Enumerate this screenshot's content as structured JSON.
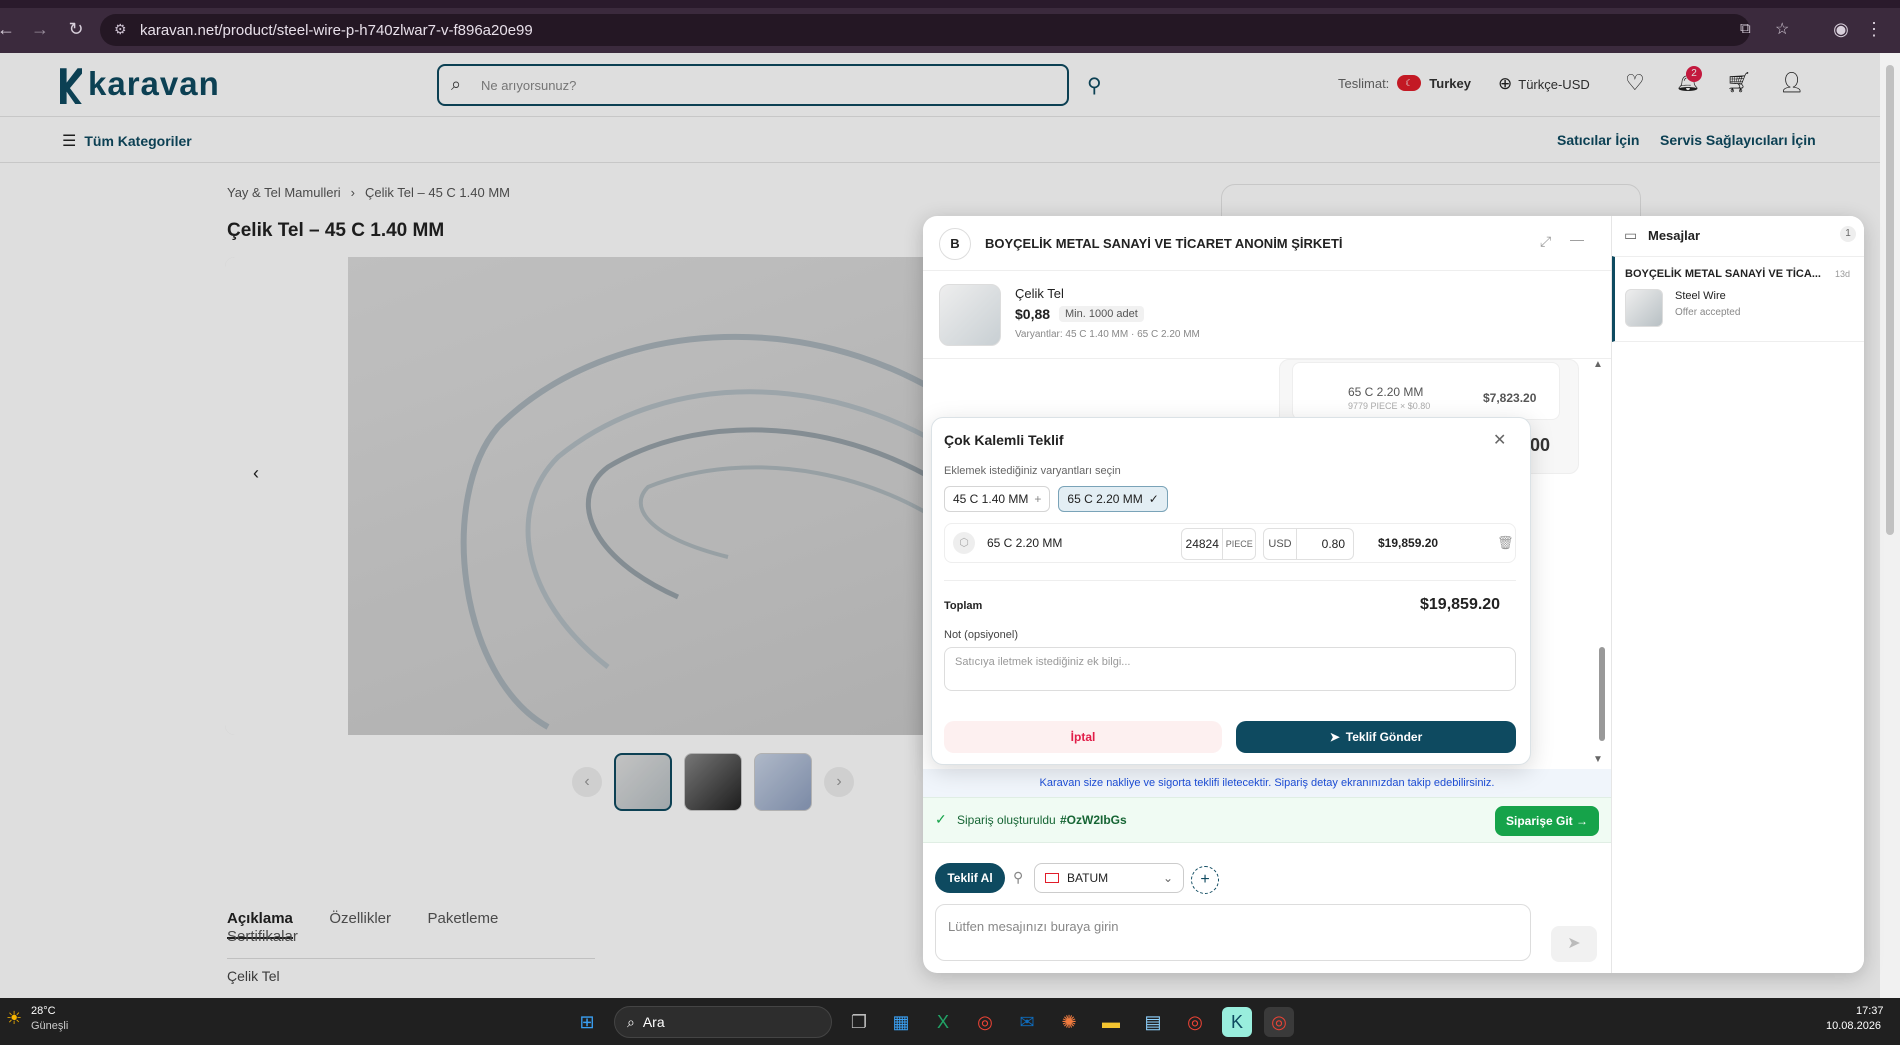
{
  "browser": {
    "url": "karavan.net/product/steel-wire-p-h740zlwar7-v-f896a20e99",
    "back_icon": "arrow-left-icon",
    "forward_icon": "arrow-right-icon",
    "reload_icon": "reload-icon"
  },
  "site": {
    "logo": "karavan",
    "search_placeholder": "Ne arıyorsunuz?",
    "delivery_label": "Teslimat:",
    "delivery_country": "Turkey",
    "language": "Türkçe-USD",
    "notifications_count": "2",
    "all_categories": "Tüm Kategoriler",
    "for_sellers": "Satıcılar İçin",
    "for_service": "Servis Sağlayıcıları İçin"
  },
  "product": {
    "breadcrumb_parent": "Yay & Tel Mamulleri",
    "breadcrumb_sep": "›",
    "breadcrumb_current": "Çelik Tel – 45 C 1.40 MM",
    "title": "Çelik Tel – 45 C 1.40 MM",
    "tabs": [
      "Açıklama",
      "Özellikler",
      "Paketleme",
      "Sertifikalar"
    ],
    "description": "Çelik Tel"
  },
  "chat": {
    "avatar_letter": "B",
    "company": "BOYÇELİK METAL SANAYİ VE TİCARET ANONİM ŞİRKETİ",
    "product_name": "Çelik Tel",
    "price": "$0,88",
    "min_order": "Min. 1000 adet",
    "variants": "Varyantlar: 45 C 1.40 MM · 65 C 2.20 MM",
    "bg_variant_name": "65 C 2.20 MM",
    "bg_variant_qty": "9779 PIECE × $0.80",
    "bg_variant_total": "$7,823.20",
    "bg_partial_total": "2.00",
    "info_banner": "Karavan size nakliye ve sigorta teklifi iletecektir. Sipariş detay ekranınızdan takip edebilirsiniz.",
    "order_created_label": "Sipariş oluşturuldu",
    "order_id": "#OzW2IbGs",
    "go_to_order": "Siparişe Git →",
    "get_quote": "Teklif Al",
    "location": "BATUM",
    "message_placeholder": "Lütfen mesajınızı buraya girin"
  },
  "modal": {
    "title": "Çok Kalemli Teklif",
    "subtitle": "Eklemek istediğiniz varyantları seçin",
    "chips": [
      {
        "label": "45 C 1.40 MM",
        "mark": "+"
      },
      {
        "label": "65 C 2.20 MM",
        "mark": "✓"
      }
    ],
    "item_name": "65 C 2.20 MM",
    "item_qty": "24824",
    "item_unit": "PIECE",
    "item_currency": "USD",
    "item_price": "0.80",
    "item_total": "$19,859.20",
    "total_label": "Toplam",
    "total_value": "$19,859.20",
    "note_label": "Not (opsiyonel)",
    "note_placeholder": "Satıcıya iletmek istediğiniz ek bilgi...",
    "cancel": "İptal",
    "send": "Teklif Gönder"
  },
  "messages": {
    "title": "Mesajlar",
    "count": "1",
    "item_company": "BOYÇELİK METAL SANAYİ VE TİCA...",
    "item_time": "13d",
    "item_product": "Steel Wire",
    "item_status": "Offer accepted"
  },
  "taskbar": {
    "temp": "28°C",
    "weather": "Güneşli",
    "search": "Ara",
    "time": "17:37",
    "date": "10.08.2026"
  },
  "colors": {
    "brand": "#0e4a60",
    "green": "#16a34a",
    "red": "#e11d48"
  }
}
